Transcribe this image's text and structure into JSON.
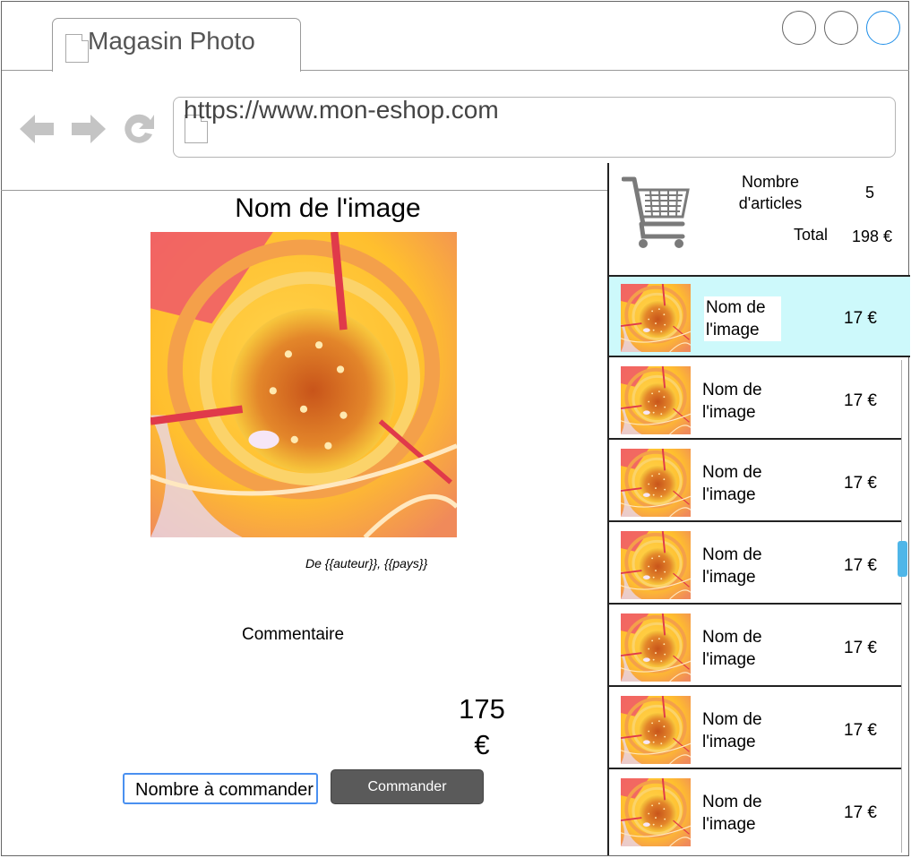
{
  "browser": {
    "tab_title": "Magasin Photo",
    "url": "https://www.mon-eshop.com",
    "window_buttons": [
      "minimize",
      "maximize",
      "close"
    ],
    "nav_icons": [
      "back-arrow-icon",
      "forward-arrow-icon",
      "reload-icon"
    ]
  },
  "product": {
    "title": "Nom de l'image",
    "author_line": "De {{auteur}}, {{pays}}",
    "comment": "Commentaire",
    "price_line1": "175",
    "price_line2": "€",
    "quantity_placeholder": "Nombre à commander",
    "order_button": "Commander"
  },
  "cart": {
    "count_label": "Nombre d'articles",
    "count_value": "5",
    "total_label": "Total",
    "total_value": "198 €",
    "items": [
      {
        "name": "Nom de l'image",
        "price": "17 €",
        "selected": true
      },
      {
        "name": "Nom de l'image",
        "price": "17 €",
        "selected": false
      },
      {
        "name": "Nom de l'image",
        "price": "17 €",
        "selected": false
      },
      {
        "name": "Nom de l'image",
        "price": "17 €",
        "selected": false
      },
      {
        "name": "Nom de l'image",
        "price": "17 €",
        "selected": false
      },
      {
        "name": "Nom de l'image",
        "price": "17 €",
        "selected": false
      },
      {
        "name": "Nom de l'image",
        "price": "17 €",
        "selected": false
      }
    ]
  },
  "colors": {
    "selected_row": "#cdf9fb",
    "focus_blue": "#4a90f0",
    "button_gray": "#5a5a5a",
    "scroll_thumb": "#4fb6e8"
  }
}
